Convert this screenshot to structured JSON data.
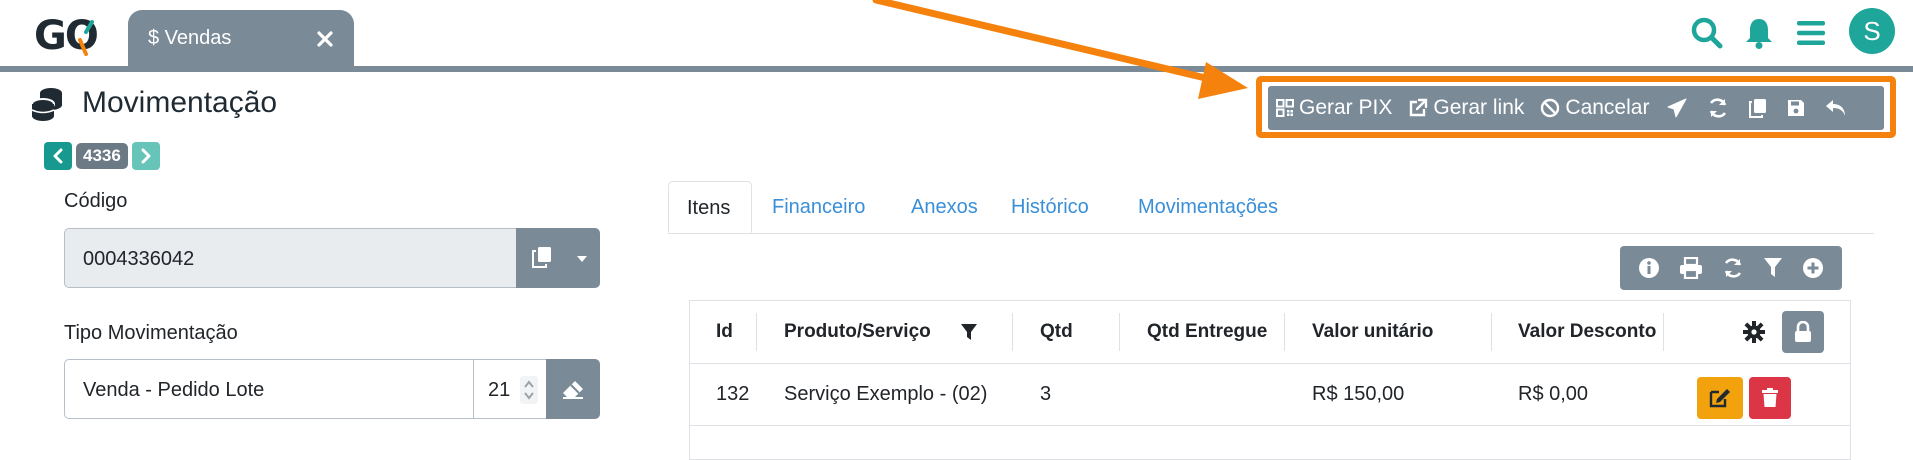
{
  "header": {
    "logo_text": "GO",
    "tab": {
      "label": "$ Vendas"
    },
    "icons": [
      "search-icon",
      "bell-icon",
      "menu-icon"
    ],
    "avatar_initial": "S",
    "accent_color": "#1ea69a"
  },
  "page": {
    "title": "Movimentação",
    "record_number": "4336"
  },
  "toolbar": {
    "gerar_pix": "Gerar PIX",
    "gerar_link": "Gerar link",
    "cancelar": "Cancelar",
    "icons": [
      "send-icon",
      "refresh-icon",
      "copy-icon",
      "save-icon",
      "undo-icon"
    ],
    "highlight_color": "#f5820c"
  },
  "form": {
    "codigo_label": "Código",
    "codigo_value": "0004336042",
    "tipo_label": "Tipo Movimentação",
    "tipo_value": "Venda - Pedido Lote",
    "tipo_number": "21"
  },
  "tabs": [
    "Itens",
    "Financeiro",
    "Anexos",
    "Histórico",
    "Movimentações"
  ],
  "grid_toolbar_icons": [
    "info-icon",
    "print-icon",
    "refresh-icon",
    "filter-icon",
    "add-icon"
  ],
  "table": {
    "columns": [
      "Id",
      "Produto/Serviço",
      "Qtd",
      "Qtd Entregue",
      "Valor unitário",
      "Valor Desconto"
    ],
    "rows": [
      {
        "id": "132",
        "produto": "Serviço Exemplo - (02)",
        "qtd": "3",
        "qtd_entregue": "",
        "valor_unitario": "R$ 150,00",
        "valor_desconto": "R$ 0,00"
      }
    ]
  }
}
